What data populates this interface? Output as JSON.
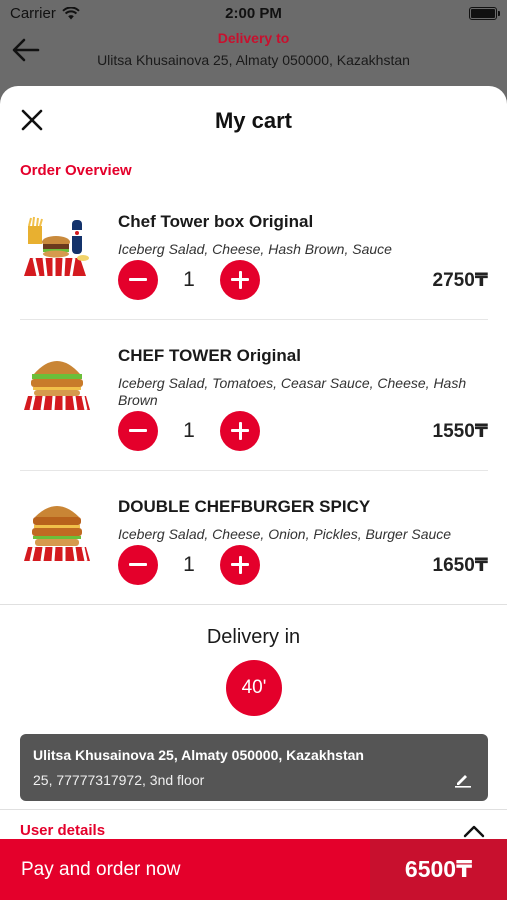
{
  "status_bar": {
    "carrier": "Carrier",
    "time": "2:00 PM"
  },
  "header": {
    "title": "Delivery to",
    "address": "Ulitsa Khusainova 25, Almaty 050000, Kazakhstan",
    "back_icon": "arrow-left-icon"
  },
  "cart": {
    "title": "My cart",
    "close_icon": "close-icon",
    "section_label": "Order Overview",
    "items": [
      {
        "name": "Chef Tower box Original",
        "description": "Iceberg Salad, Cheese, Hash Brown, Sauce",
        "quantity": "1",
        "price": "2750₸"
      },
      {
        "name": "CHEF TOWER Original",
        "description": "Iceberg Salad, Tomatoes, Ceasar Sauce, Cheese, Hash Brown",
        "quantity": "1",
        "price": "1550₸"
      },
      {
        "name": "DOUBLE CHEFBURGER SPICY",
        "description": "Iceberg Salad, Cheese, Onion, Pickles, Burger Sauce",
        "quantity": "1",
        "price": "1650₸"
      }
    ]
  },
  "delivery": {
    "label": "Delivery in",
    "time": "40'",
    "address_line1": "Ulitsa Khusainova 25, Almaty 050000, Kazakhstan",
    "address_line2": "25, 77777317972, 3nd floor"
  },
  "user_details": {
    "label": "User details"
  },
  "footer": {
    "pay_label": "Pay and order now",
    "total": "6500₸"
  },
  "colors": {
    "accent": "#e4002b",
    "accent_dark": "#c8102e",
    "card": "#555555",
    "overlay": "#6b6b6b"
  }
}
